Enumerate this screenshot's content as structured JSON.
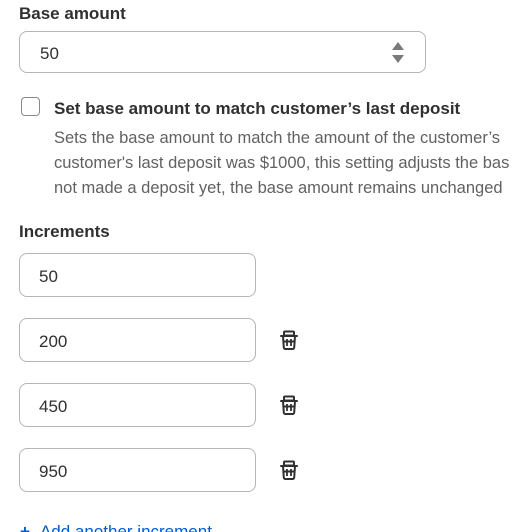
{
  "base_amount": {
    "label": "Base amount",
    "value": "50"
  },
  "match_deposit": {
    "label": "Set base amount to match customer’s last deposit",
    "checked": false,
    "help_lines": [
      "Sets the base amount to match the amount of the customer’s",
      "customer's last deposit was $1000, this setting adjusts the bas",
      "not made a deposit yet, the base amount remains unchanged"
    ]
  },
  "increments": {
    "label": "Increments",
    "items": [
      {
        "value": "50",
        "deletable": false
      },
      {
        "value": "200",
        "deletable": true
      },
      {
        "value": "450",
        "deletable": true
      },
      {
        "value": "950",
        "deletable": true
      }
    ],
    "add_label": "Add another increment"
  },
  "icons": {
    "spinner": "stepper-icon",
    "delete": "trash-icon",
    "add": "plus-icon"
  },
  "colors": {
    "text": "#303030",
    "muted": "#616161",
    "border": "#b5b5b5",
    "link": "#005bd3"
  }
}
